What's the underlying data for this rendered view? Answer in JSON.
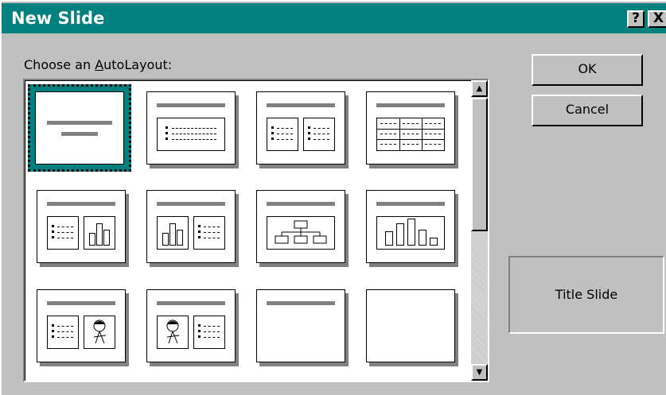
{
  "window": {
    "title": "New Slide",
    "help_glyph": "?",
    "close_glyph": "X"
  },
  "label": {
    "choose": "Choose an AutoLayout:"
  },
  "buttons": {
    "ok": "OK",
    "cancel": "Cancel"
  },
  "preview": {
    "name": "Title Slide"
  },
  "scrollbar": {
    "up_glyph": "▲",
    "down_glyph": "▼"
  },
  "layouts": [
    {
      "name": "title-slide",
      "selected": true
    },
    {
      "name": "bulleted-list"
    },
    {
      "name": "two-column-text"
    },
    {
      "name": "table"
    },
    {
      "name": "text-and-chart"
    },
    {
      "name": "chart-and-text"
    },
    {
      "name": "organization-chart"
    },
    {
      "name": "chart"
    },
    {
      "name": "text-and-clip-art"
    },
    {
      "name": "clip-art-and-text"
    },
    {
      "name": "title-only"
    },
    {
      "name": "blank"
    }
  ]
}
